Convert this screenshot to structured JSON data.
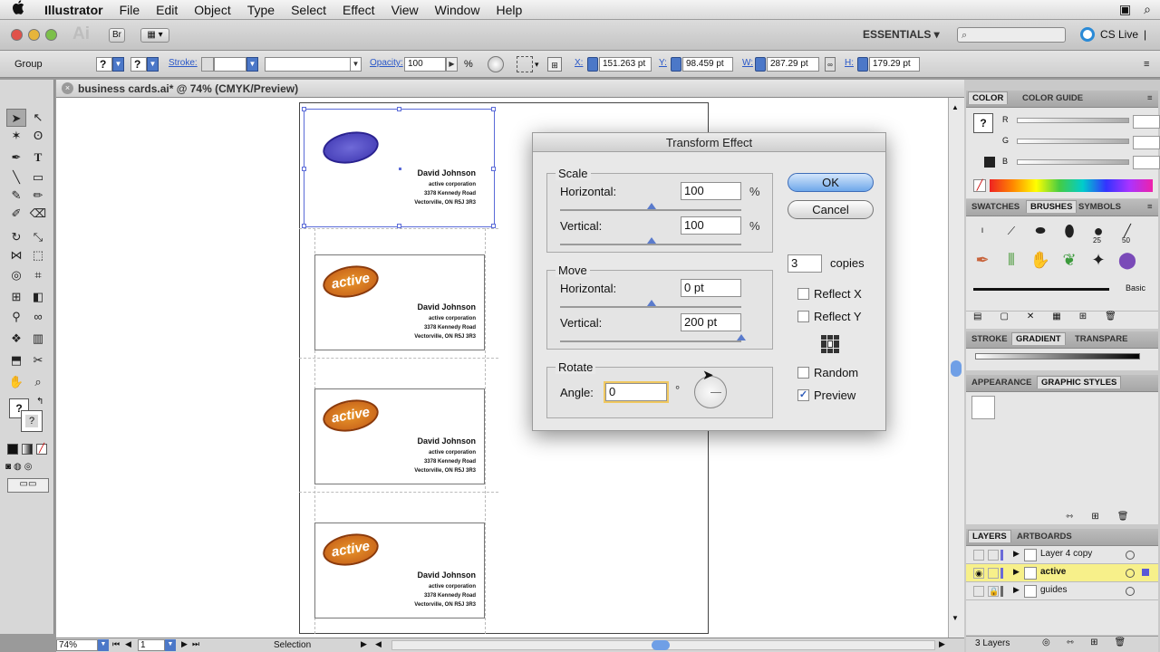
{
  "menubar": {
    "apple_icon": "",
    "app": "Illustrator",
    "items": [
      "File",
      "Edit",
      "Object",
      "Type",
      "Select",
      "Effect",
      "View",
      "Window",
      "Help"
    ]
  },
  "appbar": {
    "logo": "Ai",
    "bridge": "Br",
    "workspace": "ESSENTIALS ▾",
    "cs_live": "CS Live"
  },
  "controlbar": {
    "selection_type": "Group",
    "q1": "?",
    "q2": "?",
    "stroke_label": "Stroke:",
    "opacity_label": "Opacity:",
    "opacity_value": "100",
    "opacity_unit": "%",
    "x_label": "X:",
    "x_value": "151.263 pt",
    "y_label": "Y:",
    "y_value": "98.459 pt",
    "w_label": "W:",
    "w_value": "287.29 pt",
    "h_label": "H:",
    "h_value": "179.29 pt"
  },
  "document": {
    "tab_title": "business cards.ai* @ 74% (CMYK/Preview)",
    "close": "×"
  },
  "cards": [
    {
      "logo": "",
      "name": "David Johnson",
      "line1": "active corporation",
      "line2": "3378 Kennedy Road",
      "line3": "Vectorville, ON R5J 3R3"
    },
    {
      "logo": "active",
      "name": "David Johnson",
      "line1": "active corporation",
      "line2": "3378 Kennedy Road",
      "line3": "Vectorville, ON R5J 3R3"
    },
    {
      "logo": "active",
      "name": "David Johnson",
      "line1": "active corporation",
      "line2": "3378 Kennedy Road",
      "line3": "Vectorville, ON R5J 3R3"
    },
    {
      "logo": "active",
      "name": "David Johnson",
      "line1": "active corporation",
      "line2": "3378 Kennedy Road",
      "line3": "Vectorville, ON R5J 3R3"
    }
  ],
  "dialog": {
    "title": "Transform Effect",
    "scale": {
      "label": "Scale",
      "h_label": "Horizontal:",
      "h_value": "100",
      "h_unit": "%",
      "v_label": "Vertical:",
      "v_value": "100",
      "v_unit": "%"
    },
    "move": {
      "label": "Move",
      "h_label": "Horizontal:",
      "h_value": "0 pt",
      "v_label": "Vertical:",
      "v_value": "200 pt"
    },
    "rotate": {
      "label": "Rotate",
      "angle_label": "Angle:",
      "angle_value": "0",
      "degree": "°"
    },
    "ok": "OK",
    "cancel": "Cancel",
    "copies_value": "3",
    "copies_label": "copies",
    "reflect_x": "Reflect X",
    "reflect_y": "Reflect Y",
    "random": "Random",
    "preview": "Preview",
    "preview_checked": "✓"
  },
  "panels": {
    "color_tabs": [
      "COLOR",
      "COLOR GUIDE"
    ],
    "rgb": [
      "R",
      "G",
      "B"
    ],
    "brush_tabs": [
      "SWATCHES",
      "BRUSHES",
      "SYMBOLS"
    ],
    "brush_sizes": [
      "25",
      "50"
    ],
    "brush_basic": "Basic",
    "stroke_tabs": [
      "STROKE",
      "GRADIENT",
      "TRANSPARE"
    ],
    "appearance_tabs": [
      "APPEARANCE",
      "GRAPHIC STYLES"
    ],
    "layers_tabs": [
      "LAYERS",
      "ARTBOARDS"
    ],
    "layers": [
      {
        "name": "Layer 4 copy"
      },
      {
        "name": "active"
      },
      {
        "name": "guides"
      }
    ],
    "layers_count": "3 Layers"
  },
  "status": {
    "zoom": "74%",
    "page": "1",
    "mode": "Selection"
  }
}
